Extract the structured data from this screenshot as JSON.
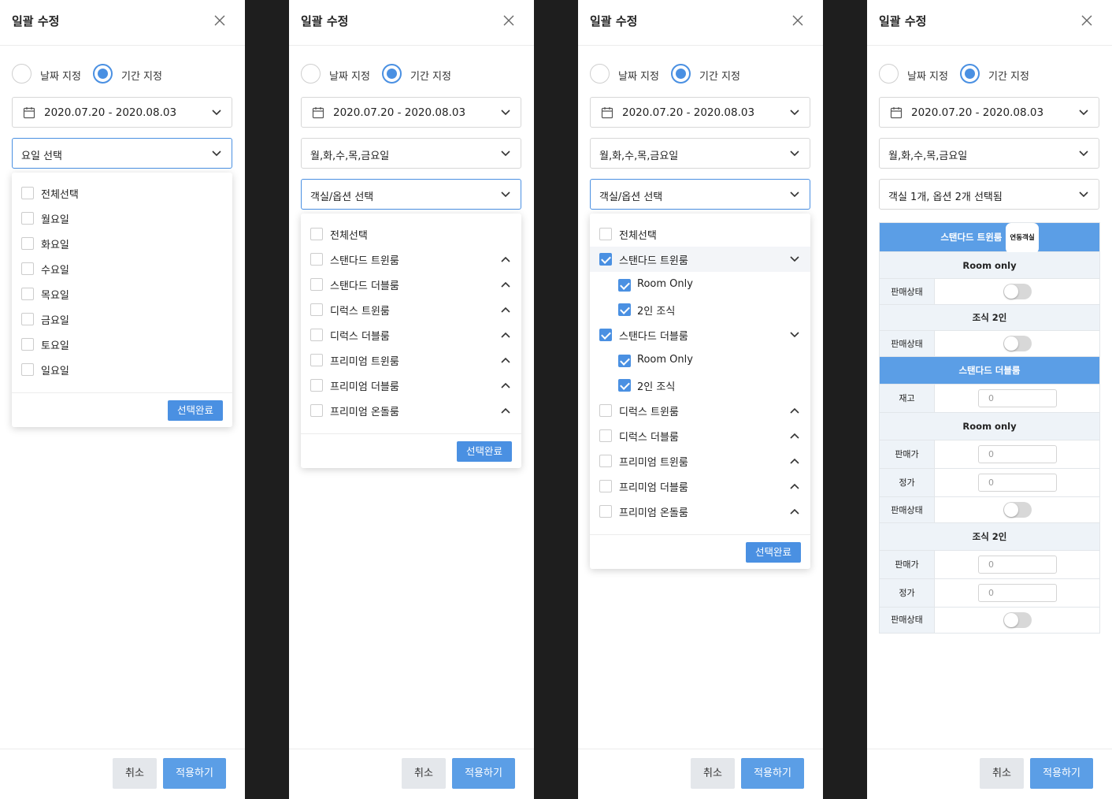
{
  "modal": {
    "title": "일괄 수정",
    "radio_date": "날짜 지정",
    "radio_period": "기간 지정",
    "date_range": "2020.07.20 - 2020.08.03",
    "cancel_label": "취소",
    "apply_label": "적용하기",
    "done_label": "선택완료"
  },
  "panel1": {
    "weekday_placeholder": "요일 선택",
    "days": [
      "전체선택",
      "월요일",
      "화요일",
      "수요일",
      "목요일",
      "금요일",
      "토요일",
      "일요일"
    ]
  },
  "panel2": {
    "weekday_value": "월,화,수,목,금요일",
    "room_placeholder": "객실/옵션 선택",
    "rooms": [
      "전체선택",
      "스탠다드 트윈룸",
      "스탠다드 더블룸",
      "디럭스 트윈룸",
      "디럭스 더블룸",
      "프리미엄 트윈룸",
      "프리미엄 더블룸",
      "프리미엄 온돌룸"
    ]
  },
  "panel3": {
    "weekday_value": "월,화,수,목,금요일",
    "room_placeholder": "객실/옵션 선택",
    "items": [
      {
        "label": "전체선택",
        "checked": false,
        "level": 0,
        "chev": "none"
      },
      {
        "label": "스탠다드 트윈룸",
        "checked": true,
        "level": 0,
        "chev": "down"
      },
      {
        "label": "Room Only",
        "checked": true,
        "level": 1,
        "chev": "none"
      },
      {
        "label": "2인 조식",
        "checked": true,
        "level": 1,
        "chev": "none"
      },
      {
        "label": "스탠다드 더블룸",
        "checked": true,
        "level": 0,
        "chev": "down"
      },
      {
        "label": "Room Only",
        "checked": true,
        "level": 1,
        "chev": "none"
      },
      {
        "label": "2인 조식",
        "checked": true,
        "level": 1,
        "chev": "none"
      },
      {
        "label": "디럭스 트윈룸",
        "checked": false,
        "level": 0,
        "chev": "up"
      },
      {
        "label": "디럭스 더블룸",
        "checked": false,
        "level": 0,
        "chev": "up"
      },
      {
        "label": "프리미엄 트윈룸",
        "checked": false,
        "level": 0,
        "chev": "up"
      },
      {
        "label": "프리미엄 더블룸",
        "checked": false,
        "level": 0,
        "chev": "up"
      },
      {
        "label": "프리미엄 온돌룸",
        "checked": false,
        "level": 0,
        "chev": "up"
      }
    ]
  },
  "panel4": {
    "weekday_value": "월,화,수,목,금요일",
    "room_value": "객실 1개, 옵션 2개 선택됨",
    "table": {
      "room1_header": "스탠다드 트윈룸",
      "room1_badge": "연동객실",
      "room_only": "Room only",
      "sale_status": "판매상태",
      "breakfast": "조식 2인",
      "room2_header": "스탠다드 더블룸",
      "stock": "재고",
      "sale_price": "판매가",
      "list_price": "정가",
      "zero": "0"
    }
  },
  "colors": {
    "accent": "#4a90e2",
    "header_blue": "#5b9ee6",
    "sub_header": "#eef3f8",
    "backdrop": "#1e1e1e"
  }
}
